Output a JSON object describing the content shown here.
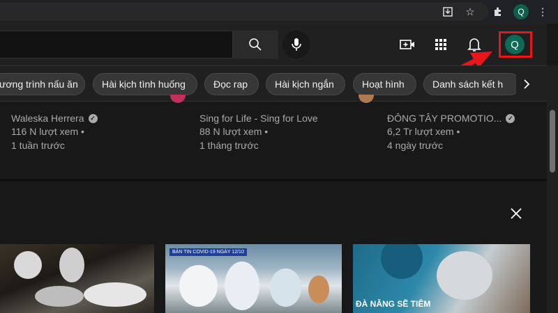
{
  "browser": {
    "icons": [
      "download-icon",
      "star-icon",
      "extensions-icon",
      "menu-dots-icon"
    ],
    "profile_initial": "Q"
  },
  "header": {
    "search_placeholder": "",
    "icons": [
      "search-icon",
      "mic-icon",
      "create-video-icon",
      "apps-icon",
      "bell-icon"
    ],
    "account_initial": "Q"
  },
  "chips": [
    {
      "label": "ương trình nấu ăn"
    },
    {
      "label": "Hài kịch tình huống"
    },
    {
      "label": "Đọc rap"
    },
    {
      "label": "Hài kịch ngắn"
    },
    {
      "label": "Hoạt hình"
    },
    {
      "label": "Danh sách kết h"
    }
  ],
  "videos": [
    {
      "channel": "Waleska Herrera",
      "verified": true,
      "views": "116 N lượt xem •",
      "time": "1 tuần trước"
    },
    {
      "channel": "Sing for Life - Sing for Love",
      "verified": false,
      "views": "88 N lượt xem •",
      "time": "1 tháng trước"
    },
    {
      "channel": "ĐÔNG TÂY PROMOTIO...",
      "verified": true,
      "views": "6,2 Tr lượt xem •",
      "time": "4 ngày trước"
    }
  ],
  "thumbnails": {
    "t2_banner": "BẢN TIN COVID-19 NGÀY 12/10",
    "t3_caption": "ĐÀ NẴNG SẼ TIÊM"
  },
  "colors": {
    "background": "#181818",
    "header": "#202020",
    "highlight": "#e8151b",
    "account": "#0d6b55"
  }
}
